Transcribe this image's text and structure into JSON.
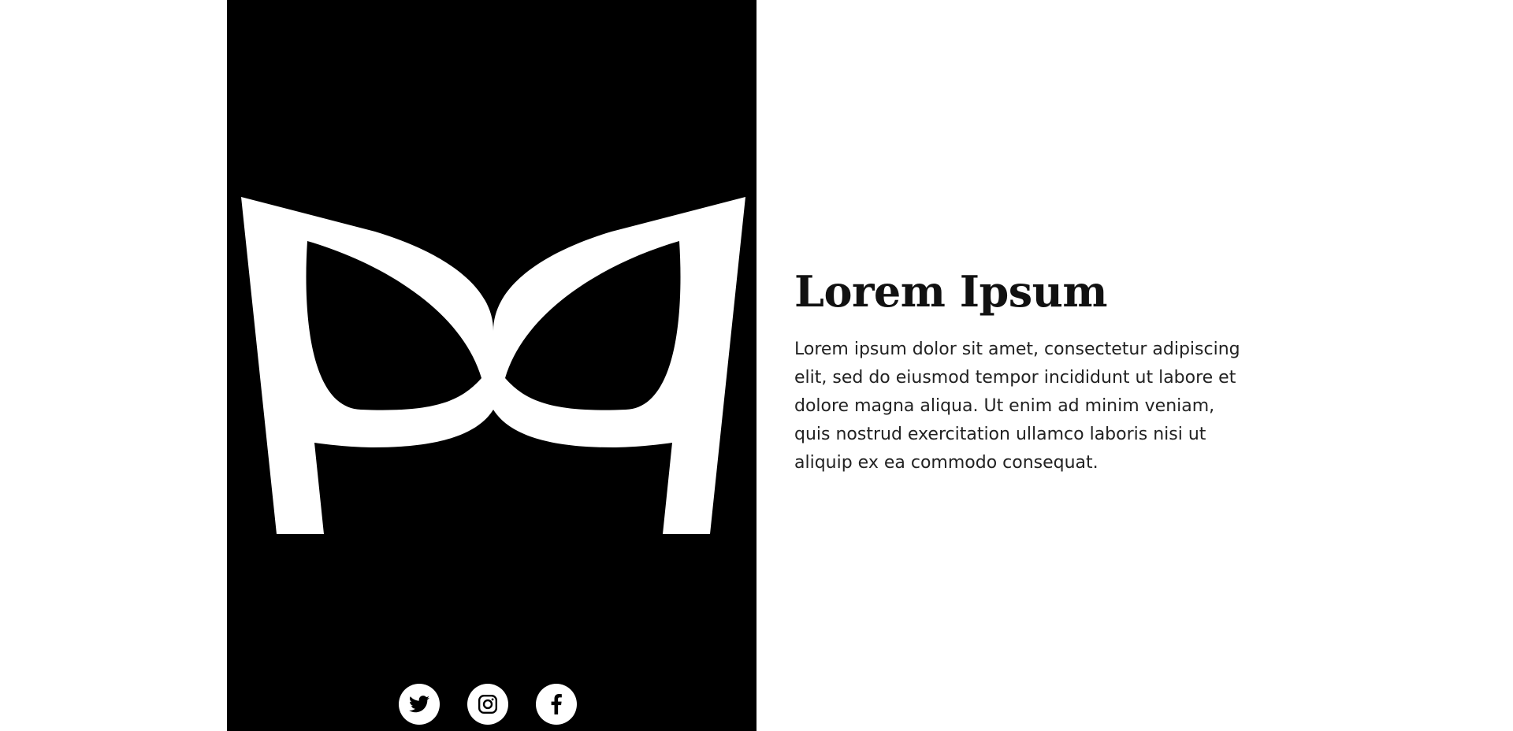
{
  "colors": {
    "panel_background": "#000000",
    "logo_fill": "#ffffff",
    "page_background": "#ffffff",
    "heading": "#111111",
    "body_text": "#222222"
  },
  "logo": {
    "icon": "butterfly-mask-logo-icon"
  },
  "social_links": [
    {
      "name": "twitter",
      "icon": "twitter-icon"
    },
    {
      "name": "instagram",
      "icon": "instagram-icon"
    },
    {
      "name": "facebook",
      "icon": "facebook-icon"
    }
  ],
  "content": {
    "title": "Lorem Ipsum",
    "paragraph": "Lorem ipsum dolor sit amet, consectetur adipiscing elit, sed do eiusmod tempor incididunt ut labore et dolore magna aliqua. Ut enim ad minim veniam, quis nostrud exercitation ullamco laboris nisi ut aliquip ex ea commodo consequat."
  }
}
